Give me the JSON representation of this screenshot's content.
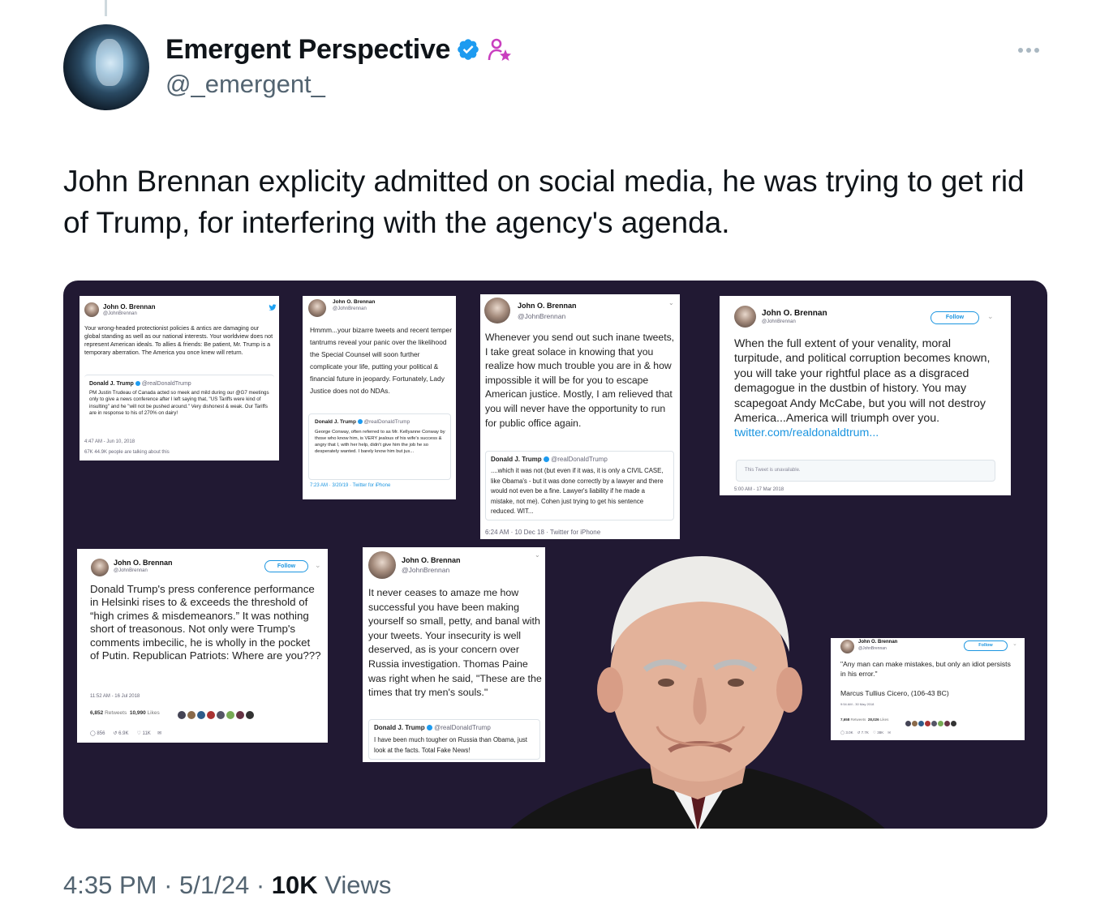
{
  "author": {
    "name": "Emergent Perspective",
    "handle": "@_emergent_"
  },
  "tweet": {
    "text": "John Brennan explicity admitted on social media, he was trying to get rid of Trump, for interfering with the agency's agenda."
  },
  "media_cards": [
    {
      "name": "John O. Brennan",
      "handle": "@JohnBrennan",
      "body": "Your wrong-headed protectionist policies & antics are damaging our global standing as well as our national interests. Your worldview does not represent American ideals. To allies & friends: Be patient, Mr. Trump is a temporary aberration. The America you once knew will return.",
      "quote_name": "Donald J. Trump",
      "quote_handle": "@realDonaldTrump",
      "quote_body": "PM Justin Trudeau of Canada acted so meek and mild during our @G7 meetings only to give a news conference after I left saying that, \"US Tariffs were kind of insulting\" and he \"will not be pushed around.\" Very dishonest & weak. Our Tariffs are in response to his of 270% on dairy!",
      "time": "4:47 AM - Jun 10, 2018",
      "stats": "67K   44.9K people are talking about this"
    },
    {
      "name": "John O. Brennan",
      "handle": "@JohnBrennan",
      "body": "Hmmm...your bizarre tweets and recent temper tantrums reveal your panic over the likelihood the Special Counsel will soon further complicate your life, putting your political & financial future in jeopardy. Fortunately, Lady Justice does not do NDAs.",
      "quote_name": "Donald J. Trump",
      "quote_handle": "@realDonaldTrump",
      "quote_body": "George Conway, often referred to as Mr. Kellyanne Conway by those who know him, is VERY jealous of his wife's success & angry that I, with her help, didn't give him the job he so desperately wanted. I barely know him but jus...",
      "time": "7:23 AM · 3/20/19 · Twitter for iPhone"
    },
    {
      "name": "John O. Brennan",
      "handle": "@JohnBrennan",
      "body": "Whenever you send out such inane tweets, I take great solace in knowing that you realize how much trouble you are in & how impossible it will be for you to escape American justice. Mostly, I am relieved that you will never have the opportunity to run for public office again.",
      "quote_name": "Donald J. Trump",
      "quote_handle": "@realDonaldTrump",
      "quote_body": "....which it was not (but even if it was, it is only a CIVIL CASE, like Obama's - but it was done correctly by a lawyer and there would not even be a fine. Lawyer's liability if he made a mistake, not me). Cohen just trying to get his sentence reduced. WIT...",
      "time": "6:24 AM · 10 Dec 18 · Twitter for iPhone"
    },
    {
      "name": "John O. Brennan",
      "handle": "@JohnBrennan",
      "follow": "Follow",
      "body": "When the full extent of your venality, moral turpitude, and political corruption becomes known, you will take your rightful place as a disgraced demagogue in the dustbin of history. You may scapegoat Andy McCabe, but you will not destroy America...America will triumph over you.",
      "link": "twitter.com/realdonaldtrum...",
      "unavailable": "This Tweet is unavailable.",
      "time": "5:00 AM - 17 Mar 2018"
    },
    {
      "name": "John O. Brennan",
      "handle": "@JohnBrennan",
      "follow": "Follow",
      "body": "Donald Trump's press conference performance in Helsinki rises to & exceeds the threshold of “high crimes & misdemeanors.” It was nothing short of treasonous. Not only were Trump's comments imbecilic, he is wholly in the pocket of Putin. Republican Patriots: Where are you???",
      "time": "11:52 AM - 16 Jul 2018",
      "retweets": "6,852",
      "retweets_label": "Retweets",
      "likes": "10,990",
      "likes_label": "Likes",
      "actions": [
        "856",
        "6.9K",
        "11K"
      ]
    },
    {
      "name": "John O. Brennan",
      "handle": "@JohnBrennan",
      "body": "It never ceases to amaze me how successful you have been making yourself so small, petty, and banal with your tweets. Your insecurity is well deserved, as is your concern over Russia investigation. Thomas Paine was right when he said, \"These are the times that try men's souls.\"",
      "quote_name": "Donald J. Trump",
      "quote_handle": "@realDonaldTrump",
      "quote_body": "I have been much tougher on Russia than Obama, just look at the facts. Total Fake News!"
    },
    {
      "name": "John O. Brennan",
      "handle": "@JohnBrennan",
      "follow": "Follow",
      "body": "\"Any man can make mistakes, but only an idiot persists in his error.\"",
      "body2": "Marcus Tullius Cicero, (106-43 BC)",
      "time": "9:54 AM - 30 May 2018",
      "retweets": "7,658",
      "retweets_label": "Retweets",
      "likes": "28,026",
      "likes_label": "Likes",
      "actions": [
        "3.0K",
        "7.7K",
        "38K"
      ]
    }
  ],
  "footer": {
    "time": "4:35 PM",
    "sep1": " · ",
    "date": "5/1/24",
    "sep2": " · ",
    "views_count": "10K",
    "views_label": " Views"
  },
  "colors": {
    "media_background": "#211933",
    "verified_blue": "#1d9bf0",
    "affiliate_pink": "#c93fbf",
    "secondary_text": "#536471"
  },
  "icons": [
    "verified-badge-icon",
    "affiliate-person-icon",
    "more-options-icon",
    "twitter-bird-icon",
    "heart-icon",
    "reply-icon",
    "retweet-icon",
    "chevron-down-icon"
  ]
}
